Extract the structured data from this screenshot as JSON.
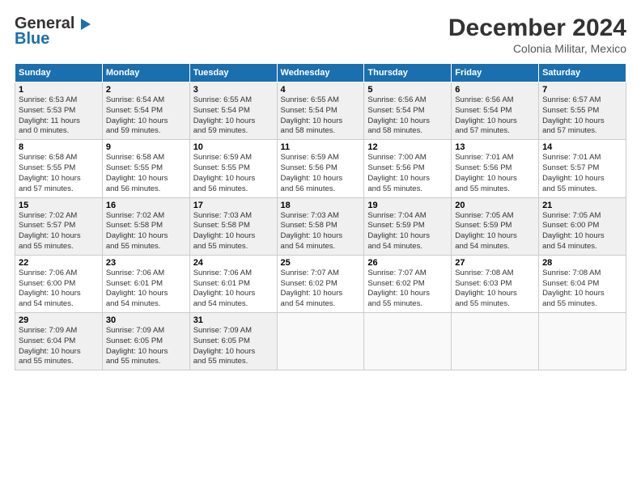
{
  "header": {
    "logo_line1": "General",
    "logo_line2": "Blue",
    "month": "December 2024",
    "location": "Colonia Militar, Mexico"
  },
  "weekdays": [
    "Sunday",
    "Monday",
    "Tuesday",
    "Wednesday",
    "Thursday",
    "Friday",
    "Saturday"
  ],
  "weeks": [
    [
      {
        "day": "1",
        "sunrise": "6:53 AM",
        "sunset": "5:53 PM",
        "daylight": "11 hours and 0 minutes."
      },
      {
        "day": "2",
        "sunrise": "6:54 AM",
        "sunset": "5:54 PM",
        "daylight": "10 hours and 59 minutes."
      },
      {
        "day": "3",
        "sunrise": "6:55 AM",
        "sunset": "5:54 PM",
        "daylight": "10 hours and 59 minutes."
      },
      {
        "day": "4",
        "sunrise": "6:55 AM",
        "sunset": "5:54 PM",
        "daylight": "10 hours and 58 minutes."
      },
      {
        "day": "5",
        "sunrise": "6:56 AM",
        "sunset": "5:54 PM",
        "daylight": "10 hours and 58 minutes."
      },
      {
        "day": "6",
        "sunrise": "6:56 AM",
        "sunset": "5:54 PM",
        "daylight": "10 hours and 57 minutes."
      },
      {
        "day": "7",
        "sunrise": "6:57 AM",
        "sunset": "5:55 PM",
        "daylight": "10 hours and 57 minutes."
      }
    ],
    [
      {
        "day": "8",
        "sunrise": "6:58 AM",
        "sunset": "5:55 PM",
        "daylight": "10 hours and 57 minutes."
      },
      {
        "day": "9",
        "sunrise": "6:58 AM",
        "sunset": "5:55 PM",
        "daylight": "10 hours and 56 minutes."
      },
      {
        "day": "10",
        "sunrise": "6:59 AM",
        "sunset": "5:55 PM",
        "daylight": "10 hours and 56 minutes."
      },
      {
        "day": "11",
        "sunrise": "6:59 AM",
        "sunset": "5:56 PM",
        "daylight": "10 hours and 56 minutes."
      },
      {
        "day": "12",
        "sunrise": "7:00 AM",
        "sunset": "5:56 PM",
        "daylight": "10 hours and 55 minutes."
      },
      {
        "day": "13",
        "sunrise": "7:01 AM",
        "sunset": "5:56 PM",
        "daylight": "10 hours and 55 minutes."
      },
      {
        "day": "14",
        "sunrise": "7:01 AM",
        "sunset": "5:57 PM",
        "daylight": "10 hours and 55 minutes."
      }
    ],
    [
      {
        "day": "15",
        "sunrise": "7:02 AM",
        "sunset": "5:57 PM",
        "daylight": "10 hours and 55 minutes."
      },
      {
        "day": "16",
        "sunrise": "7:02 AM",
        "sunset": "5:58 PM",
        "daylight": "10 hours and 55 minutes."
      },
      {
        "day": "17",
        "sunrise": "7:03 AM",
        "sunset": "5:58 PM",
        "daylight": "10 hours and 55 minutes."
      },
      {
        "day": "18",
        "sunrise": "7:03 AM",
        "sunset": "5:58 PM",
        "daylight": "10 hours and 54 minutes."
      },
      {
        "day": "19",
        "sunrise": "7:04 AM",
        "sunset": "5:59 PM",
        "daylight": "10 hours and 54 minutes."
      },
      {
        "day": "20",
        "sunrise": "7:05 AM",
        "sunset": "5:59 PM",
        "daylight": "10 hours and 54 minutes."
      },
      {
        "day": "21",
        "sunrise": "7:05 AM",
        "sunset": "6:00 PM",
        "daylight": "10 hours and 54 minutes."
      }
    ],
    [
      {
        "day": "22",
        "sunrise": "7:06 AM",
        "sunset": "6:00 PM",
        "daylight": "10 hours and 54 minutes."
      },
      {
        "day": "23",
        "sunrise": "7:06 AM",
        "sunset": "6:01 PM",
        "daylight": "10 hours and 54 minutes."
      },
      {
        "day": "24",
        "sunrise": "7:06 AM",
        "sunset": "6:01 PM",
        "daylight": "10 hours and 54 minutes."
      },
      {
        "day": "25",
        "sunrise": "7:07 AM",
        "sunset": "6:02 PM",
        "daylight": "10 hours and 54 minutes."
      },
      {
        "day": "26",
        "sunrise": "7:07 AM",
        "sunset": "6:02 PM",
        "daylight": "10 hours and 55 minutes."
      },
      {
        "day": "27",
        "sunrise": "7:08 AM",
        "sunset": "6:03 PM",
        "daylight": "10 hours and 55 minutes."
      },
      {
        "day": "28",
        "sunrise": "7:08 AM",
        "sunset": "6:04 PM",
        "daylight": "10 hours and 55 minutes."
      }
    ],
    [
      {
        "day": "29",
        "sunrise": "7:09 AM",
        "sunset": "6:04 PM",
        "daylight": "10 hours and 55 minutes."
      },
      {
        "day": "30",
        "sunrise": "7:09 AM",
        "sunset": "6:05 PM",
        "daylight": "10 hours and 55 minutes."
      },
      {
        "day": "31",
        "sunrise": "7:09 AM",
        "sunset": "6:05 PM",
        "daylight": "10 hours and 55 minutes."
      },
      null,
      null,
      null,
      null
    ]
  ],
  "labels": {
    "sunrise": "Sunrise:",
    "sunset": "Sunset:",
    "daylight": "Daylight:"
  }
}
